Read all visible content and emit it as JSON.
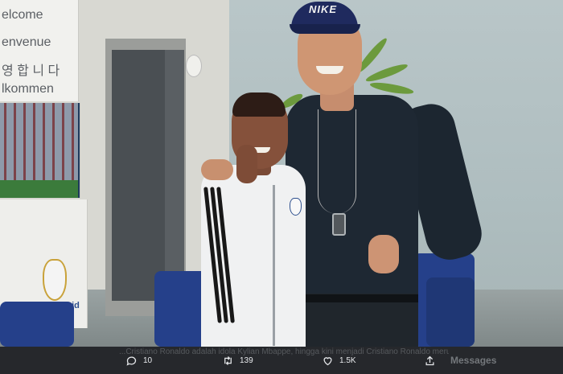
{
  "scene": {
    "banner_words": [
      "elcome",
      "envenue",
      "영 합 니 다",
      "lkommen"
    ],
    "crest_text": "adrid",
    "cap_logo": "NIKE"
  },
  "tweet": {
    "caption": "...Cristiano Ronaldo adalah idola Kylian Mbappe, hingga kini menjadi Cristiano Ronaldo merupakan idola bagi pesepak bola muda...",
    "actions": [
      {
        "name": "reply",
        "icon": "speech-bubble-icon",
        "count": "10"
      },
      {
        "name": "retweet",
        "icon": "retweet-icon",
        "count": "139"
      },
      {
        "name": "like",
        "icon": "heart-icon",
        "count": "1.5K"
      },
      {
        "name": "share",
        "icon": "share-icon",
        "count": ""
      }
    ],
    "messages_label": "Messages"
  },
  "colors": {
    "bar_background": "#26282c",
    "bar_text": "#e8eaed"
  }
}
